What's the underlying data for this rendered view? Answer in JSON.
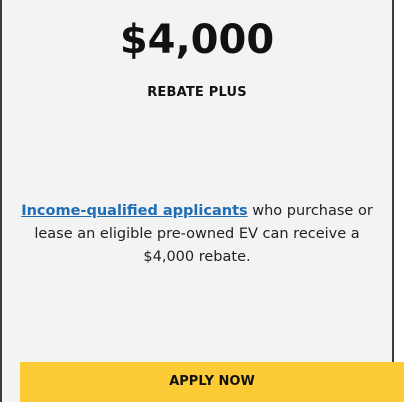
{
  "card": {
    "amount": "$4,000",
    "subtitle": "REBATE PLUS",
    "description_link": "Income-qualified applicants",
    "description_text": " who purchase or lease an eligible pre-owned EV can receive a $4,000 rebate.",
    "apply_label": "APPLY NOW"
  },
  "colors": {
    "link": "#1e6db5",
    "button": "#fdcb36",
    "card_background": "#f3f3f3"
  }
}
